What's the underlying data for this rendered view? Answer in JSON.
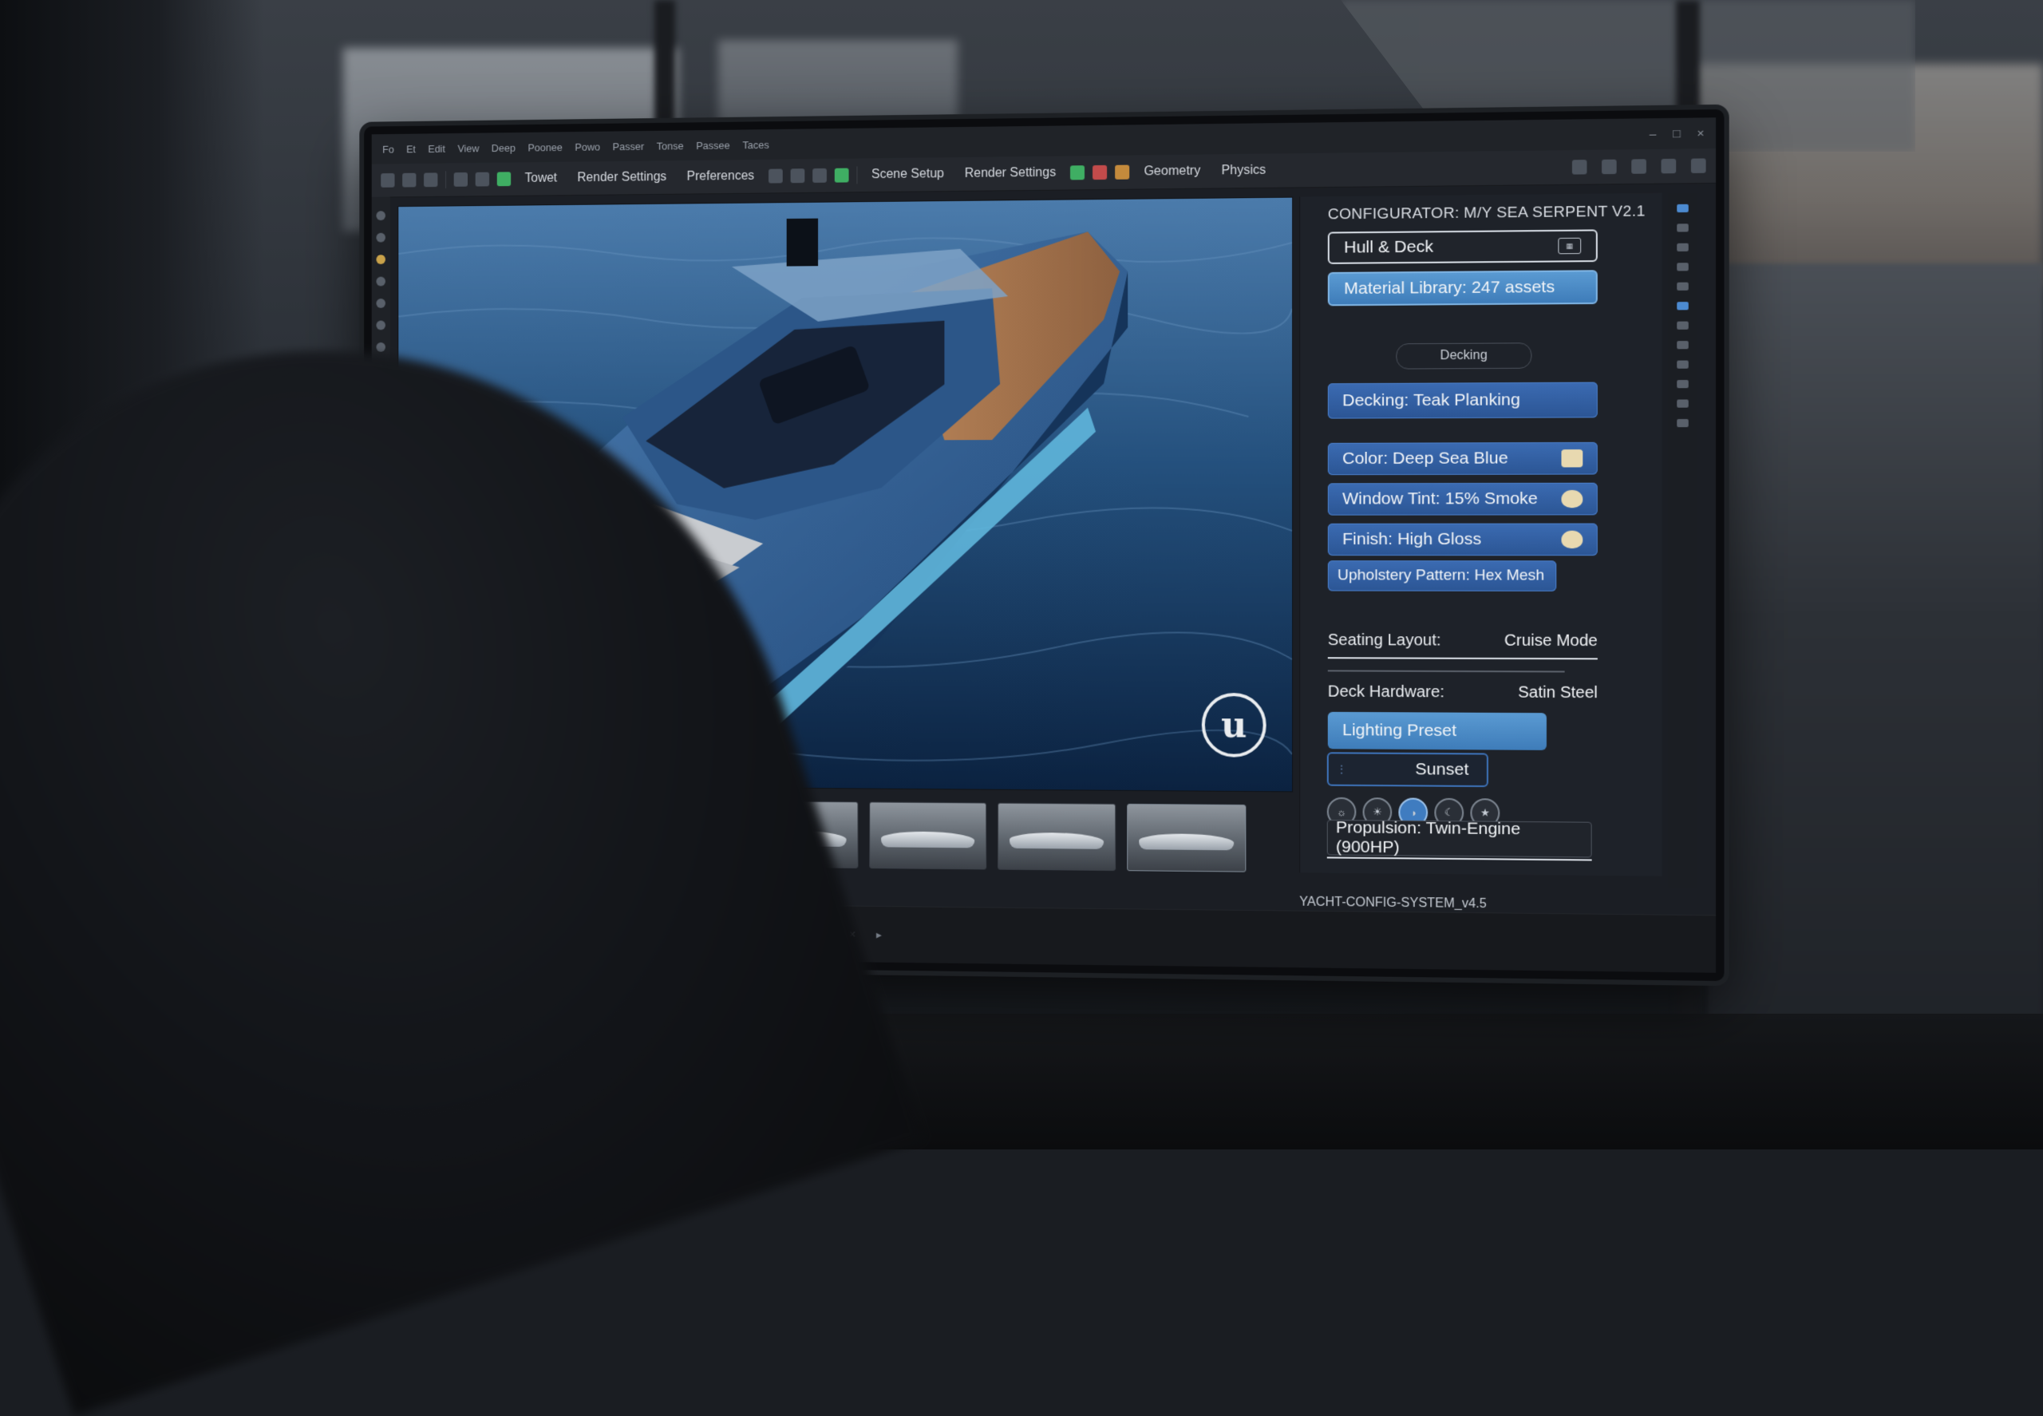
{
  "menubar": {
    "items": [
      "Fo",
      "Et",
      "Edit",
      "View",
      "Deep",
      "Poonee",
      "Powo",
      "Passer",
      "Tonse",
      "Passee",
      "Taces"
    ]
  },
  "toolbar": {
    "left_tabs": [
      "Towet",
      "Render Settings",
      "Preferences"
    ],
    "mid_tabs": [
      "Scene Setup",
      "Render Settings"
    ],
    "right_tabs": [
      "Geometry",
      "Physics"
    ]
  },
  "panel": {
    "title": "CONFIGURATOR: M/Y SEA SERPENT V2.1",
    "hull_deck": "Hull & Deck",
    "material_library": "Material Library: 247 assets",
    "decking_pill": "Decking",
    "decking": "Decking: Teak Planking",
    "color": "Color: Deep Sea Blue",
    "window_tint": "Window Tint: 15% Smoke",
    "finish": "Finish: High Gloss",
    "upholstery": "Upholstery Pattern: Hex Mesh",
    "seating_label": "Seating Layout:",
    "seating_value": "Cruise Mode",
    "hardware_label": "Deck Hardware:",
    "hardware_value": "Satin Steel",
    "lighting": "Lighting Preset",
    "sunset": "Sunset",
    "propulsion": "Propulsion:  Twin-Engine (900HP)",
    "footer": "YACHT-CONFIG-SYSTEM_v4.5"
  },
  "colors": {
    "accent_blue": "#3b6bb2",
    "light_blue": "#5a9ad2",
    "hull_blue": "#2f5a8a",
    "teak": "#a8734a"
  },
  "icons": [
    "unreal-engine-logo",
    "hull-deck-box-icon",
    "swatch-icon",
    "chip-icons"
  ]
}
